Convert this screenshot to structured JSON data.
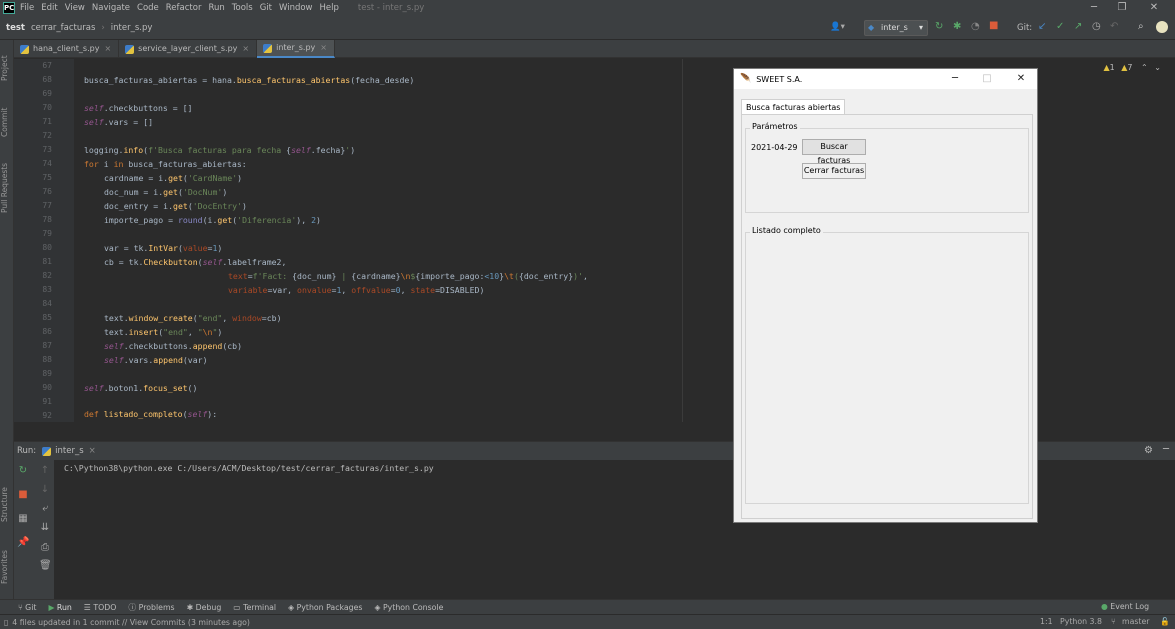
{
  "menubar": {
    "items": [
      "File",
      "Edit",
      "View",
      "Navigate",
      "Code",
      "Refactor",
      "Run",
      "Tools",
      "Git",
      "Window",
      "Help"
    ],
    "window_title": "test - inter_s.py"
  },
  "navbar": {
    "crumbs": [
      "test",
      "cerrar_facturas",
      "inter_s.py"
    ],
    "run_config": "inter_s",
    "git_label": "Git:"
  },
  "tabs": [
    {
      "label": "hana_client_s.py"
    },
    {
      "label": "service_layer_client_s.py"
    },
    {
      "label": "inter_s.py"
    }
  ],
  "side_labels": {
    "project": "Project",
    "commit": "Commit",
    "pull_requests": "Pull Requests",
    "structure": "Structure",
    "favorites": "Favorites"
  },
  "inspections": {
    "warn_a": "1",
    "warn_b": "7"
  },
  "editor": {
    "line_numbers": [
      "67",
      "68",
      "69",
      "70",
      "71",
      "72",
      "73",
      "74",
      "75",
      "76",
      "77",
      "78",
      "79",
      "80",
      "81",
      "82",
      "83",
      "84",
      "85",
      "86",
      "87",
      "88",
      "89",
      "90",
      "91",
      "92"
    ]
  },
  "run_panel": {
    "label": "Run:",
    "tab": "inter_s",
    "console_line": "C:\\Python38\\python.exe C:/Users/ACM/Desktop/test/cerrar_facturas/inter_s.py"
  },
  "bottom_tools": [
    "Git",
    "Run",
    "TODO",
    "Problems",
    "Debug",
    "Terminal",
    "Python Packages",
    "Python Console"
  ],
  "event_log": "Event Log",
  "status": {
    "message": "4 files updated in 1 commit // View Commits (3 minutes ago)",
    "position": "1:1",
    "interpreter": "Python 3.8",
    "branch": "master"
  },
  "tk_window": {
    "title": "SWEET S.A.",
    "notebook_tab": "Busca facturas abiertas",
    "params_frame": "Parámetros",
    "date": "2021-04-29",
    "search_button": "Buscar facturas",
    "close_button": "Cerrar facturas",
    "list_frame": "Listado completo"
  }
}
